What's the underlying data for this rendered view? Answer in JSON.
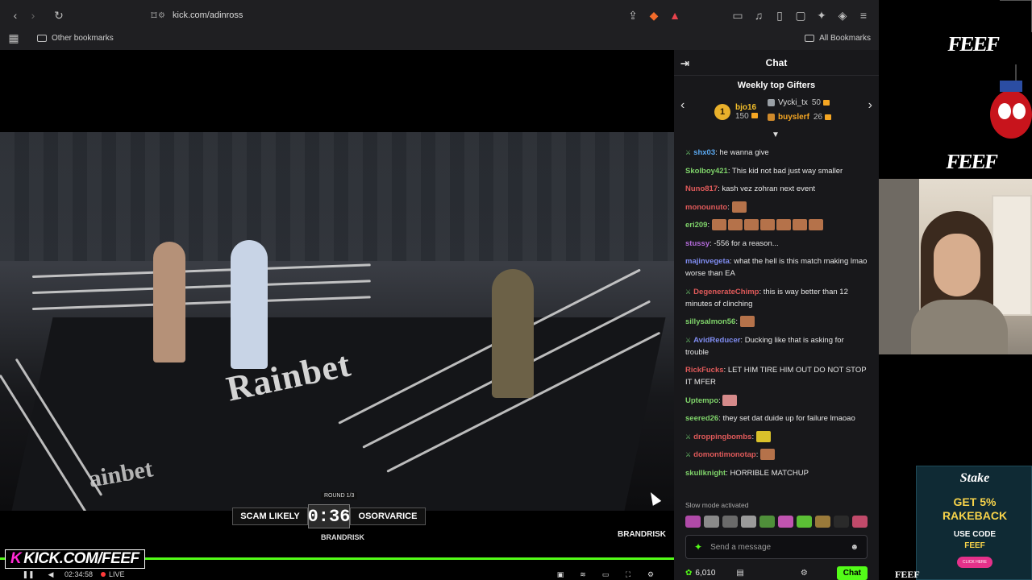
{
  "browser": {
    "url": "kick.com/adinross",
    "bookmarks_left": "Other bookmarks",
    "bookmarks_right": "All Bookmarks"
  },
  "video": {
    "scorebug": {
      "left_name": "SCAM LIKELY",
      "time": "0:36",
      "right_name": "OSORVARICE",
      "round": "ROUND 1/3",
      "sponsor": "BRANDRISK"
    },
    "sponsor_corner": "BRANDRISK",
    "ring_logo": "Rainbet",
    "ring_logo_2": "ainbet",
    "progress": 1.0,
    "controls": {
      "elapsed": "02:34:58",
      "live_label": "LIVE"
    },
    "overlay_url": "KICK.COM/FEEF"
  },
  "chat": {
    "title": "Chat",
    "gifters_title": "Weekly top Gifters",
    "gifters": [
      {
        "rank": "1",
        "name": "bjo16",
        "count": "150"
      },
      {
        "name": "Vycki_tx",
        "count": "50"
      },
      {
        "name": "buyslerf",
        "count": "26"
      }
    ],
    "messages": [
      {
        "user": "shx03",
        "color": "#5aa8f0",
        "mod": true,
        "text": "he wanna give"
      },
      {
        "user": "Skolboy421",
        "color": "#7fd36a",
        "mod": false,
        "text": "This kid not bad just way smaller"
      },
      {
        "user": "Nuno817",
        "color": "#e05a5a",
        "mod": false,
        "text": "kash vez zohran next event"
      },
      {
        "user": "monounuto",
        "color": "#e05a5a",
        "mod": false,
        "text": ""
      },
      {
        "user": "eri209",
        "color": "#7fd36a",
        "mod": false,
        "text": ""
      },
      {
        "user": "stussy",
        "color": "#b36ad9",
        "mod": false,
        "text": "-556 for a reason..."
      },
      {
        "user": "majinvegeta",
        "color": "#7f8cf0",
        "mod": false,
        "text": "what the hell is this match making lmao worse than EA"
      },
      {
        "user": "DegenerateChimp",
        "color": "#e05a5a",
        "mod": true,
        "text": "this is way better than 12 minutes of clinching"
      },
      {
        "user": "sillysalmon56",
        "color": "#7fd36a",
        "mod": false,
        "text": ""
      },
      {
        "user": "AvidReducer",
        "color": "#7f8cf0",
        "mod": true,
        "text": "Ducking like that is asking for trouble"
      },
      {
        "user": "RickFucks",
        "color": "#e05a5a",
        "mod": false,
        "text": "LET HIM TIRE HIM OUT DO NOT STOP IT MFER"
      },
      {
        "user": "Uptempo",
        "color": "#7fd36a",
        "mod": false,
        "text": ""
      },
      {
        "user": "seered26",
        "color": "#7fd36a",
        "mod": false,
        "text": "they set dat duide up for failure lmaoao"
      },
      {
        "user": "droppingbombs",
        "color": "#e05a5a",
        "mod": true,
        "text": ""
      },
      {
        "user": "domontimonotap",
        "color": "#e05a5a",
        "mod": true,
        "text": ""
      },
      {
        "user": "skullknight",
        "color": "#7fd36a",
        "mod": false,
        "text": "HORRIBLE MATCHUP"
      }
    ],
    "slow_mode": "Slow mode activated",
    "input_placeholder": "Send a message",
    "points": "6,010",
    "send_label": "Chat"
  },
  "side": {
    "feef_top": "FEEF",
    "feef_mid": "FEEF",
    "stake": {
      "logo": "Stake",
      "offer_line1": "GET 5%",
      "offer_line2": "RAKEBACK",
      "code_label": "USE CODE",
      "code": "FEEF",
      "btn": "CLICK HERE"
    },
    "feef_bottom": "FEEF"
  }
}
